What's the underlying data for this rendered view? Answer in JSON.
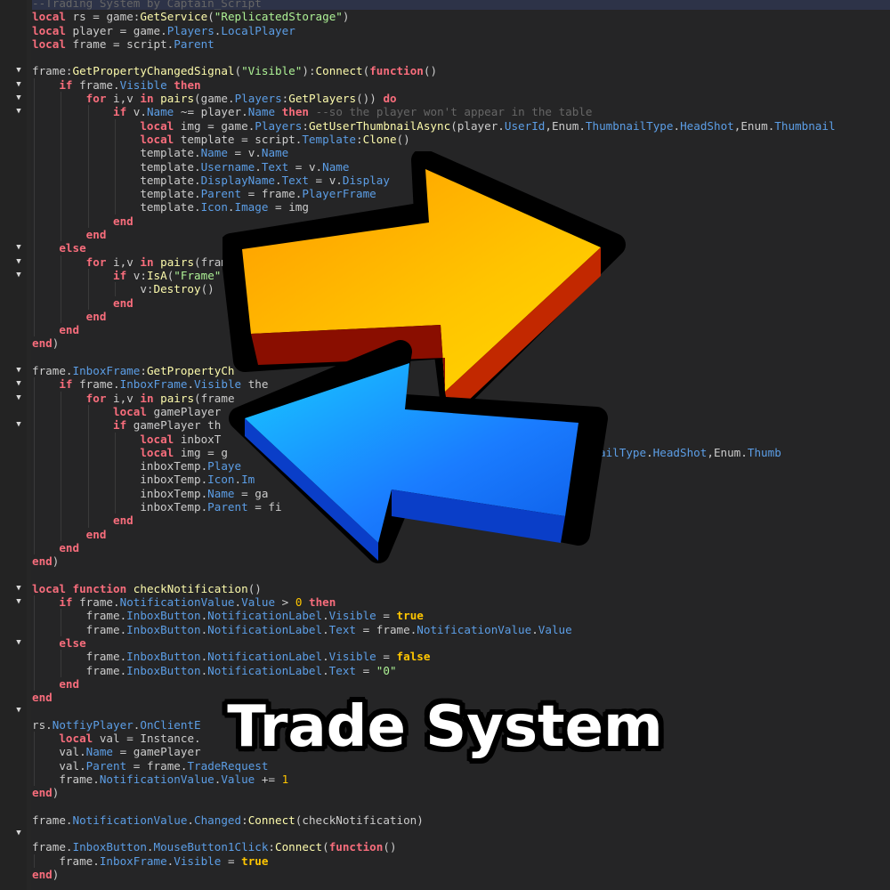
{
  "title": "Trade System",
  "icon": "trade-arrows-icon",
  "colors": {
    "background": "#252526",
    "keyword": "#f86d7c",
    "property": "#5c9ee6",
    "string": "#adf195",
    "number": "#ffc600",
    "comment": "#666666",
    "arrow_orange": "#ffb400",
    "arrow_blue": "#1e8cff"
  },
  "code": {
    "lines": [
      "--Trading System by Captain_Script",
      "local rs = game:GetService(\"ReplicatedStorage\")",
      "local player = game.Players.LocalPlayer",
      "local frame = script.Parent",
      "",
      "frame:GetPropertyChangedSignal(\"Visible\"):Connect(function()",
      "    if frame.Visible then",
      "        for i,v in pairs(game.Players:GetPlayers()) do",
      "            if v.Name ~= player.Name then --so the player won't appear in the table",
      "                local img = game.Players:GetUserThumbnailAsync(player.UserId,Enum.ThumbnailType.HeadShot,Enum.Thumbnail",
      "                local template = script.Template:Clone()",
      "                template.Name = v.Name",
      "                template.Username.Text = v.Name",
      "                template.DisplayName.Text = v.Display",
      "                template.Parent = frame.PlayerFrame",
      "                template.Icon.Image = img",
      "            end",
      "        end",
      "    else",
      "        for i,v in pairs(fram",
      "            if v:IsA(\"Frame\"",
      "                v:Destroy()",
      "            end",
      "        end",
      "    end",
      "end)",
      "",
      "frame.InboxFrame:GetPropertyCh                                ion()",
      "    if frame.InboxFrame.Visible the",
      "        for i,v in pairs(frame",
      "            local gamePlayer",
      "            if gamePlayer th",
      "                local inboxT",
      "                local img = g                                         Id,Enum.ThumbnailType.HeadShot,Enum.Thumb",
      "                inboxTemp.Playe                                       e with you!\"",
      "                inboxTemp.Icon.Im",
      "                inboxTemp.Name = ga",
      "                inboxTemp.Parent = fi",
      "            end",
      "        end",
      "    end",
      "end)",
      "",
      "local function checkNotification()",
      "    if frame.NotificationValue.Value > 0 then",
      "        frame.InboxButton.NotificationLabel.Visible = true",
      "        frame.InboxButton.NotificationLabel.Text = frame.NotificationValue.Value",
      "    else",
      "        frame.InboxButton.NotificationLabel.Visible = false",
      "        frame.InboxButton.NotificationLabel.Text = \"0\"",
      "    end",
      "end",
      "",
      "rs.NotfiyPlayer.OnClientE                         am",
      "    local val = Instance.",
      "    val.Name = gamePlayer",
      "    val.Parent = frame.TradeRequest",
      "    frame.NotificationValue.Value += 1",
      "end)",
      "",
      "frame.NotificationValue.Changed:Connect(checkNotification)",
      "",
      "frame.InboxButton.MouseButton1Click:Connect(function()",
      "    frame.InboxFrame.Visible = true",
      "end)"
    ],
    "fold_lines": [
      5,
      6,
      7,
      8,
      18,
      19,
      20,
      27,
      28,
      29,
      31,
      43,
      44,
      47,
      52,
      61
    ]
  }
}
